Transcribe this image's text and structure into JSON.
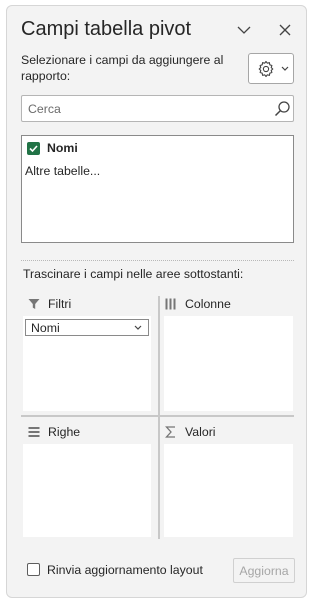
{
  "panel": {
    "title": "Campi tabella pivot",
    "instructions": "Selezionare i campi da aggiungere al rapporto:",
    "tools_icon": "gear-icon",
    "collapse_icon": "chevron-down-icon",
    "close_icon": "close-icon"
  },
  "search": {
    "placeholder": "Cerca",
    "value": ""
  },
  "field_list": {
    "fields": [
      {
        "label": "Nomi",
        "checked": true
      }
    ],
    "more_tables": "Altre tabelle..."
  },
  "areas": {
    "drag_hint": "Trascinare i campi nelle aree sottostanti:",
    "filters": {
      "label": "Filtri",
      "icon": "filter-icon",
      "items": [
        "Nomi"
      ]
    },
    "columns": {
      "label": "Colonne",
      "icon": "columns-icon",
      "items": []
    },
    "rows": {
      "label": "Righe",
      "icon": "rows-icon",
      "items": []
    },
    "values": {
      "label": "Valori",
      "icon": "sigma-icon",
      "items": []
    }
  },
  "footer": {
    "defer_label": "Rinvia aggiornamento layout",
    "defer_checked": false,
    "update_label": "Aggiorna"
  },
  "colors": {
    "checkbox_checked": "#217346",
    "panel_bg": "#f3f3f3",
    "disabled_text": "#a6a6a6"
  }
}
